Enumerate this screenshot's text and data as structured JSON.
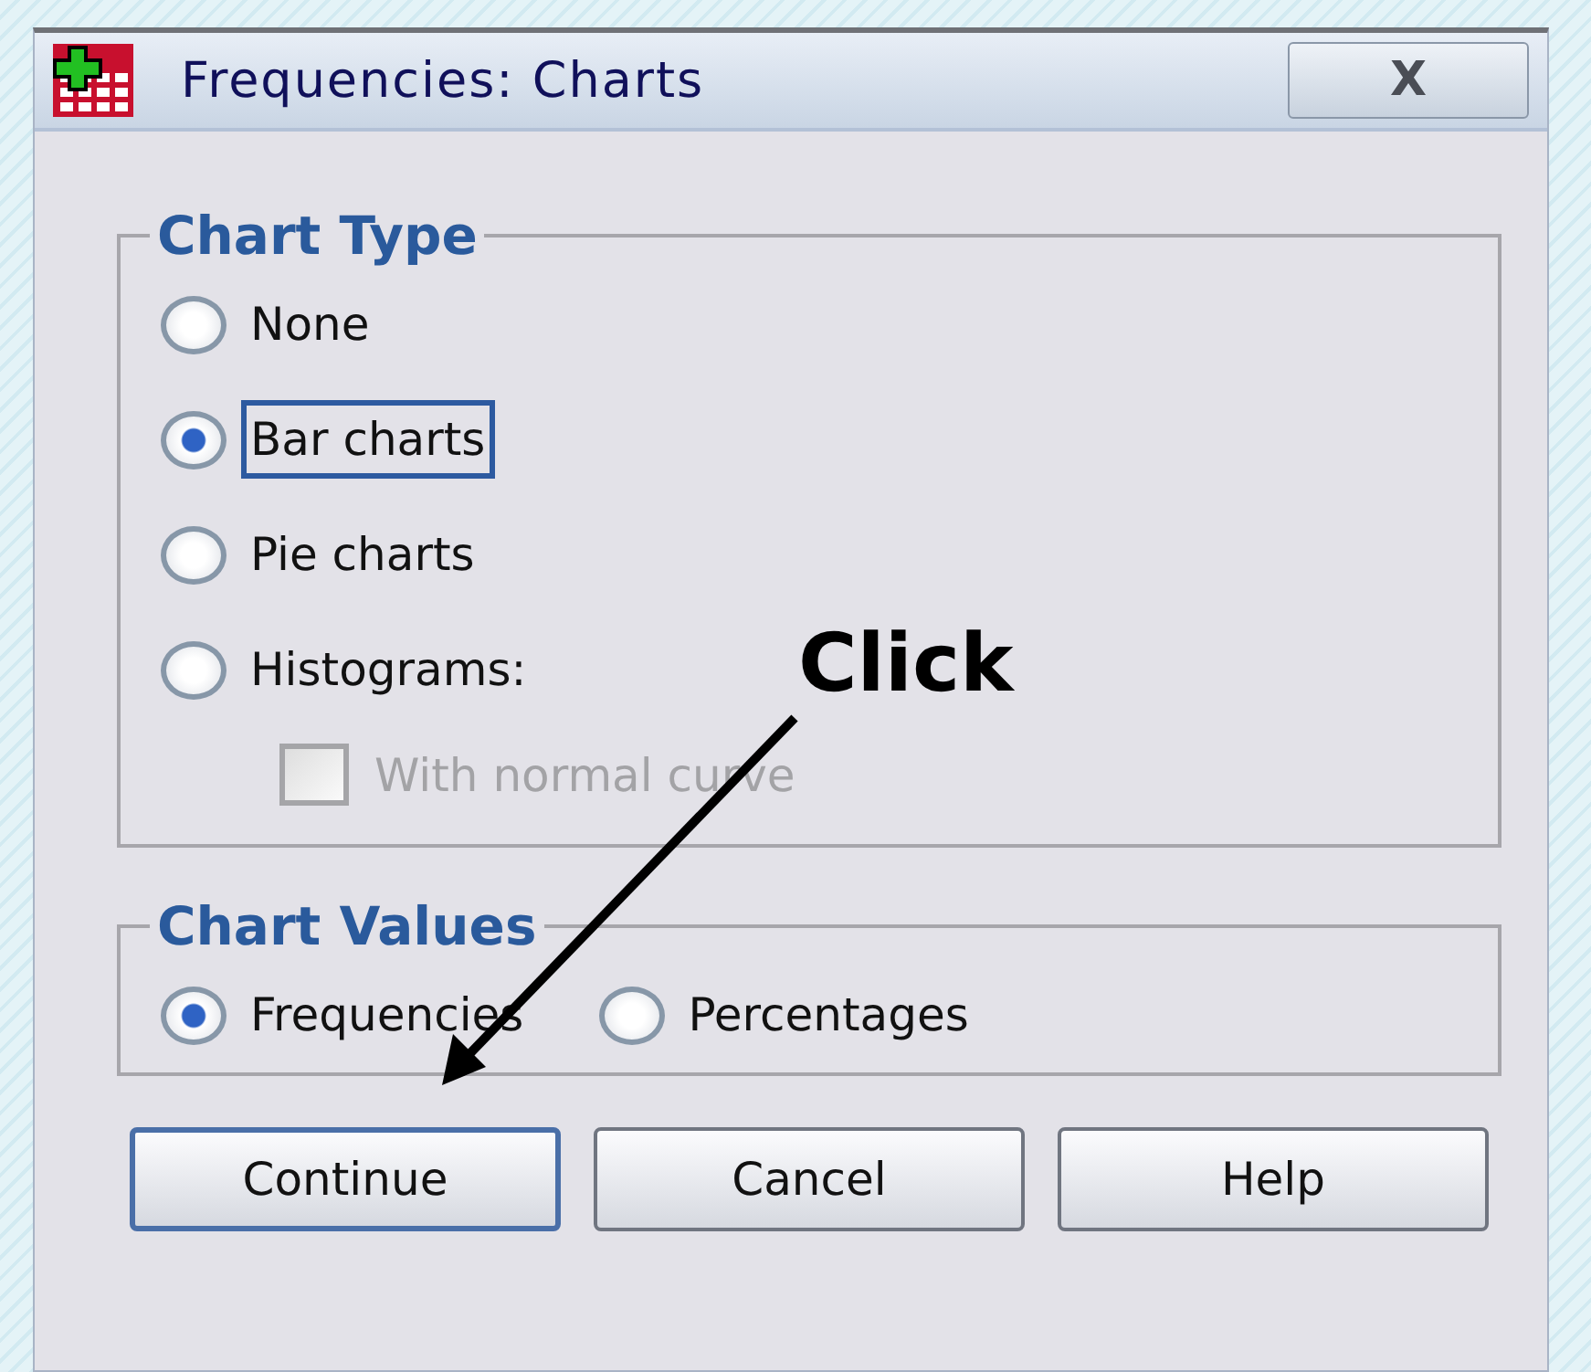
{
  "window": {
    "title": "Frequencies: Charts",
    "close_label": "X"
  },
  "chart_type": {
    "title": "Chart Type",
    "options": [
      {
        "label": "None",
        "selected": false,
        "focused": false
      },
      {
        "label": "Bar charts",
        "selected": true,
        "focused": true
      },
      {
        "label": "Pie charts",
        "selected": false,
        "focused": false
      },
      {
        "label": "Histograms:",
        "selected": false,
        "focused": false
      }
    ],
    "normal_curve": {
      "label": "With normal curve",
      "checked": false,
      "disabled": true
    }
  },
  "chart_values": {
    "title": "Chart Values",
    "options": [
      {
        "label": "Frequencies",
        "selected": true
      },
      {
        "label": "Percentages",
        "selected": false
      }
    ]
  },
  "buttons": [
    {
      "label": "Continue",
      "default": true
    },
    {
      "label": "Cancel",
      "default": false
    },
    {
      "label": "Help",
      "default": false
    }
  ],
  "annotation": {
    "text": "Click"
  }
}
